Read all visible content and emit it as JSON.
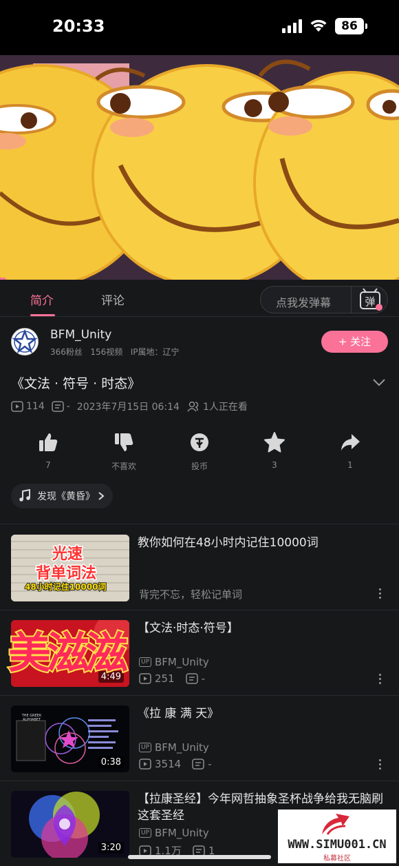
{
  "status_bar": {
    "time": "20:33",
    "battery": "86"
  },
  "tabs": {
    "intro": "简介",
    "comments": "评论",
    "danmaku_placeholder": "点我发弹幕"
  },
  "uploader": {
    "name": "BFM_Unity",
    "fans": "366粉丝",
    "videos": "156视频",
    "ip": "IP属地：辽宁",
    "follow_label": "+ 关注"
  },
  "video": {
    "title": "《文法 · 符号 · 时态》",
    "plays": "114",
    "danmaku_count": "-",
    "date": "2023年7月15日 06:14",
    "watching": "1人正在看"
  },
  "actions": [
    {
      "icon": "thumb-up-icon",
      "label": "7"
    },
    {
      "icon": "thumb-down-icon",
      "label": "不喜欢"
    },
    {
      "icon": "coin-icon",
      "label": "投币"
    },
    {
      "icon": "star-icon",
      "label": "3"
    },
    {
      "icon": "share-icon",
      "label": "1"
    }
  ],
  "music_chip": "发现《黄昏》",
  "related": [
    {
      "title": "教你如何在48小时内记住10000词",
      "subtitle": "背完不忘，轻松记单词",
      "thumb_line1": "光速",
      "thumb_line2": "背单词法",
      "thumb_line3": "48小时记住10000词"
    },
    {
      "title": "【文法·时态·符号】",
      "author": "BFM_Unity",
      "plays": "251",
      "danmaku": "-",
      "duration": "4:49"
    },
    {
      "title": "《拉 康 满 天》",
      "author": "BFM_Unity",
      "plays": "3514",
      "danmaku": "-",
      "duration": "0:38",
      "thumb_label": "THE GREEK ALPHABET"
    },
    {
      "title": "【拉康圣经】今年网哲抽象圣杯战争给我无脑刷这套圣经",
      "author": "BFM_Unity",
      "plays": "1.1万",
      "danmaku": "1",
      "duration": "3:20"
    }
  ],
  "sticker_text": "美滋滋",
  "watermark": {
    "site": "WWW.SIMU001.CN",
    "label": "私募社区"
  },
  "colors": {
    "accent": "#fb7299",
    "background": "#17181a"
  }
}
